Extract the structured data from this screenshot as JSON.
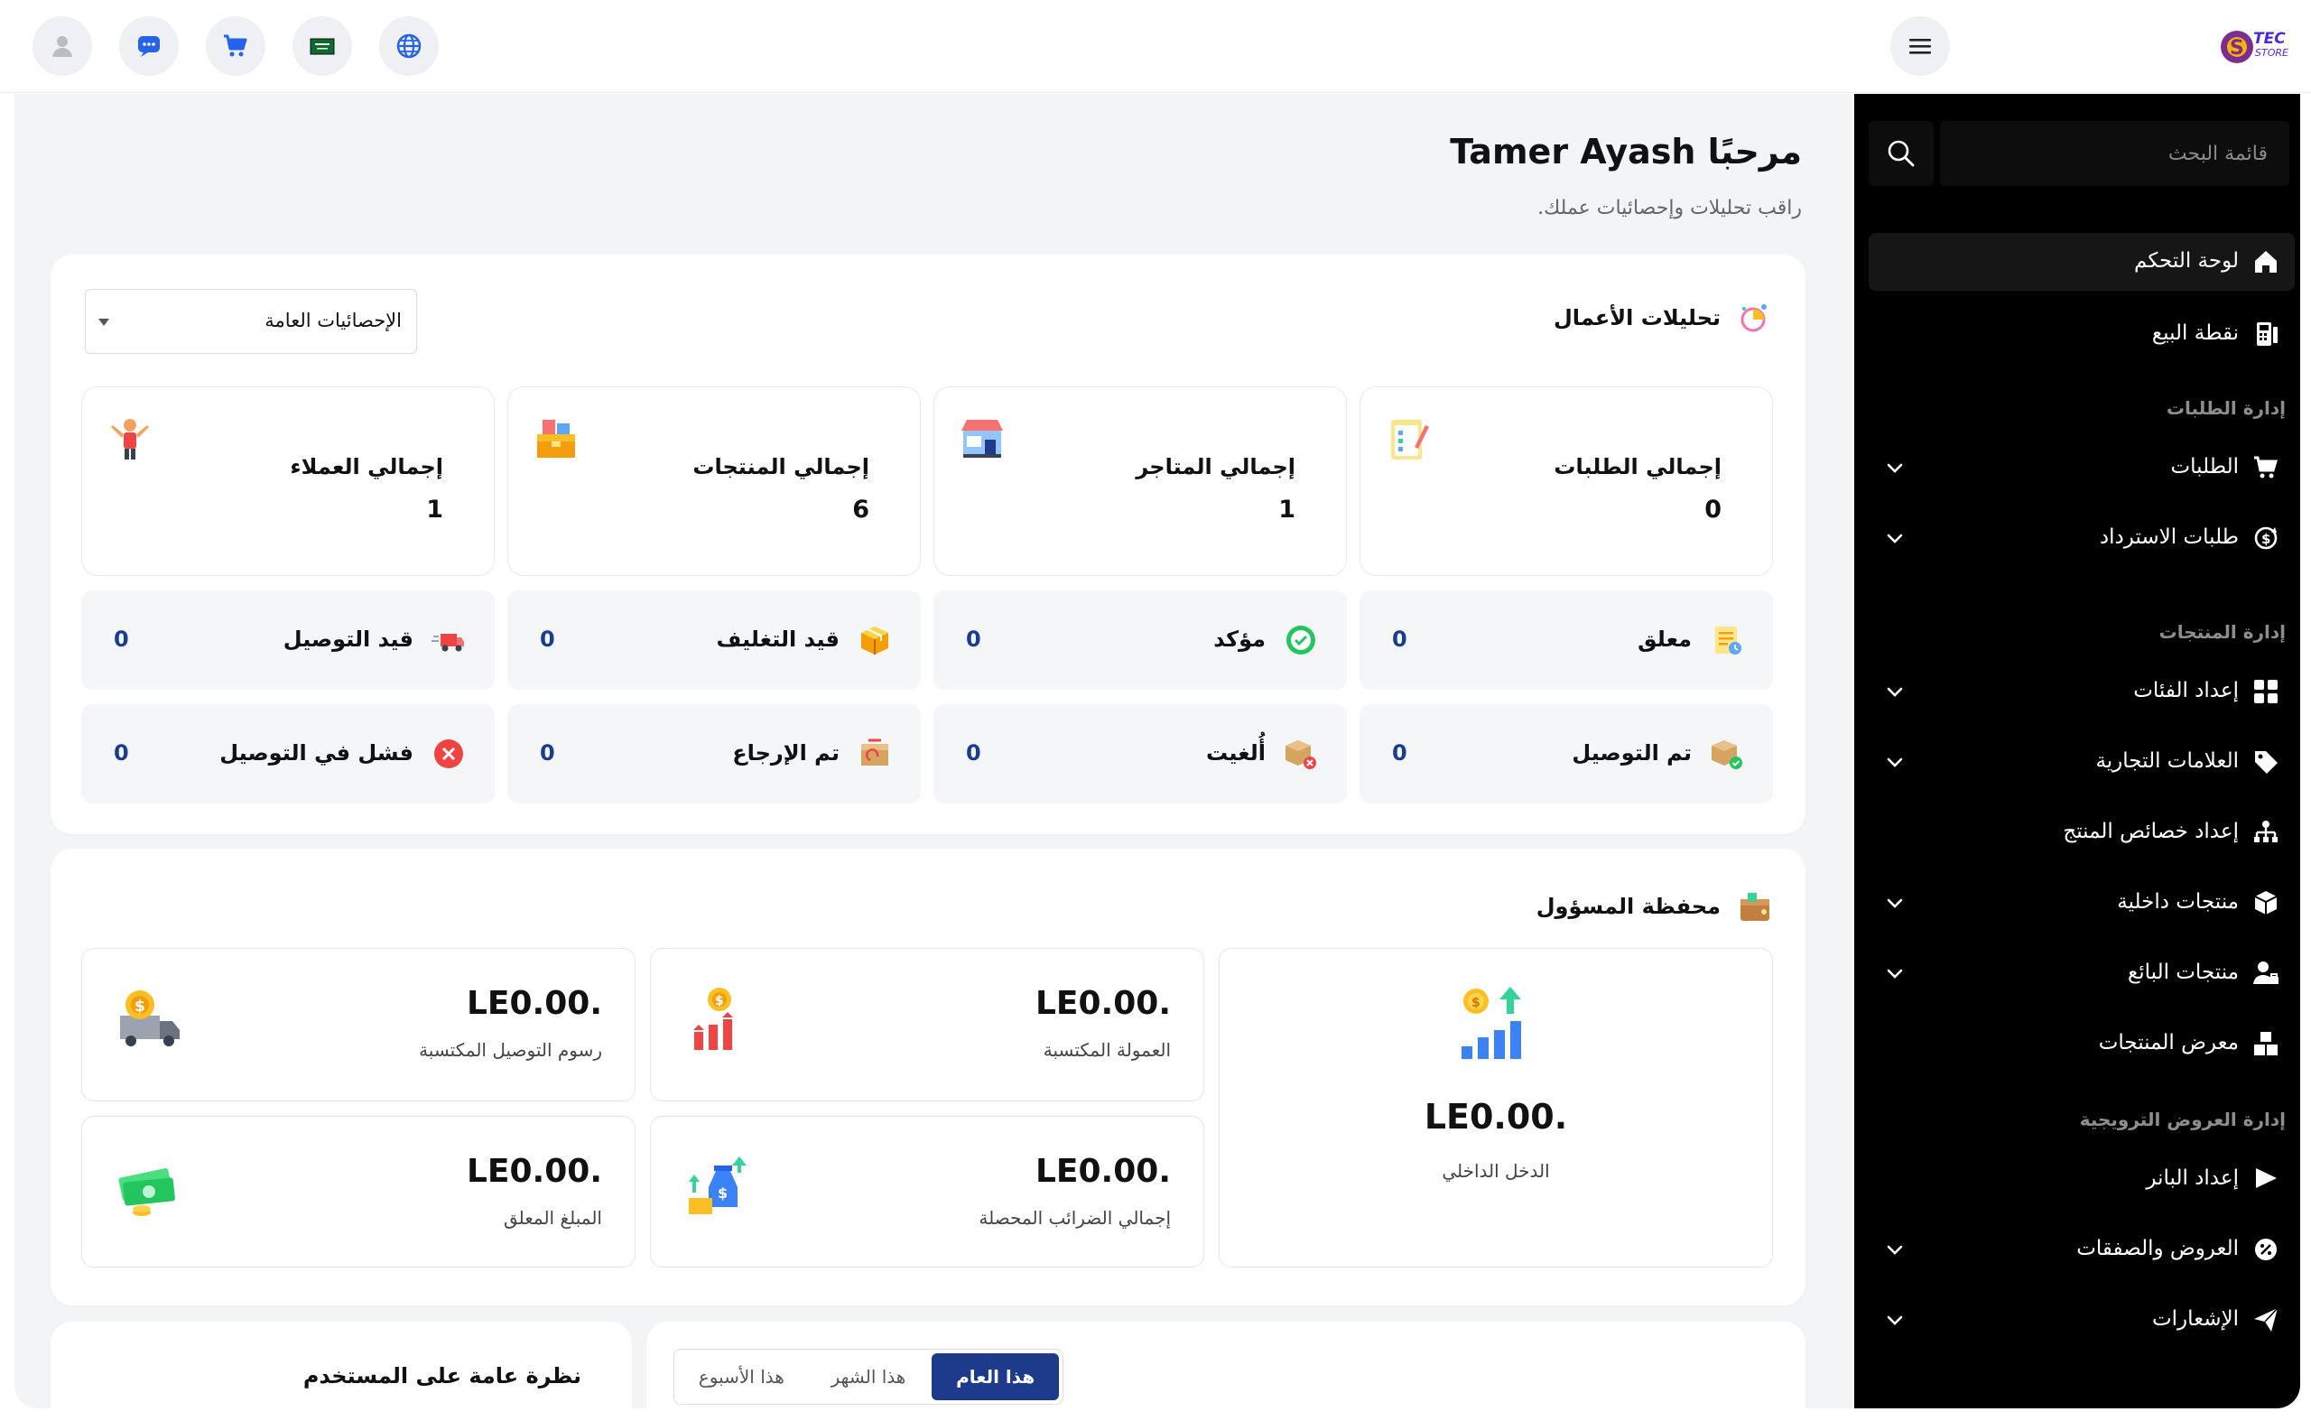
{
  "header": {
    "icons": [
      "avatar-icon",
      "chat-icon",
      "cart-icon",
      "flag-icon",
      "globe-icon",
      "menu-icon"
    ],
    "logo_text": "TEC STORE"
  },
  "welcome": {
    "title": "مرحبًا Tamer Ayash",
    "subtitle": "راقب تحليلات وإحصائيات عملك."
  },
  "analytics": {
    "title": "تحليلات الأعمال",
    "filter_selected": "الإحصائيات العامة",
    "totals": [
      {
        "label": "إجمالي الطلبات",
        "value": "0",
        "icon": "clipboard-icon"
      },
      {
        "label": "إجمالي المتاجر",
        "value": "1",
        "icon": "store-icon"
      },
      {
        "label": "إجمالي المنتجات",
        "value": "6",
        "icon": "products-box-icon"
      },
      {
        "label": "إجمالي العملاء",
        "value": "1",
        "icon": "customer-icon"
      }
    ],
    "statuses_row1": [
      {
        "label": "معلق",
        "value": "0",
        "icon": "pending-icon"
      },
      {
        "label": "مؤكد",
        "value": "0",
        "icon": "confirmed-icon"
      },
      {
        "label": "قيد التغليف",
        "value": "0",
        "icon": "packaging-icon"
      },
      {
        "label": "قيد التوصيل",
        "value": "0",
        "icon": "delivery-truck-icon"
      }
    ],
    "statuses_row2": [
      {
        "label": "تم التوصيل",
        "value": "0",
        "icon": "delivered-icon"
      },
      {
        "label": "أُلغيت",
        "value": "0",
        "icon": "canceled-icon"
      },
      {
        "label": "تم الإرجاع",
        "value": "0",
        "icon": "returned-icon"
      },
      {
        "label": "فشل في التوصيل",
        "value": "0",
        "icon": "failed-icon"
      }
    ]
  },
  "wallet": {
    "title": "محفظة المسؤول",
    "inhouse": {
      "amount": "LE0.00.",
      "label": "الدخل الداخلي"
    },
    "commission": {
      "amount": "LE0.00.",
      "label": "العمولة المكتسبة"
    },
    "delivery_fees": {
      "amount": "LE0.00.",
      "label": "رسوم التوصيل المكتسبة"
    },
    "taxes": {
      "amount": "LE0.00.",
      "label": "إجمالي الضرائب المحصلة"
    },
    "pending": {
      "amount": "LE0.00.",
      "label": "المبلغ المعلق"
    }
  },
  "user_overview": {
    "title": "نظرة عامة على المستخدم"
  },
  "period_tabs": {
    "year": "هذا العام",
    "month": "هذا الشهر",
    "week": "هذا الأسبوع"
  },
  "sidebar": {
    "search_placeholder": "قائمة البحث",
    "dashboard": "لوحة التحكم",
    "pos": "نقطة البيع",
    "sec_orders": "إدارة الطلبات",
    "orders": "الطلبات",
    "refunds": "طلبات الاسترداد",
    "sec_products": "إدارة المنتجات",
    "categories": "إعداد الفئات",
    "brands": "العلامات التجارية",
    "attributes": "إعداد خصائص المنتج",
    "inhouse_products": "منتجات داخلية",
    "vendor_products": "منتجات البائع",
    "gallery": "معرض المنتجات",
    "sec_promotions": "إدارة العروض الترويجية",
    "banners": "إعداد البانر",
    "offers": "العروض والصفقات",
    "notifications": "الإشعارات"
  },
  "colors": {
    "accent": "#1e3a8a",
    "value_blue": "#1a3d8f",
    "sidebar_bg": "#000000"
  }
}
